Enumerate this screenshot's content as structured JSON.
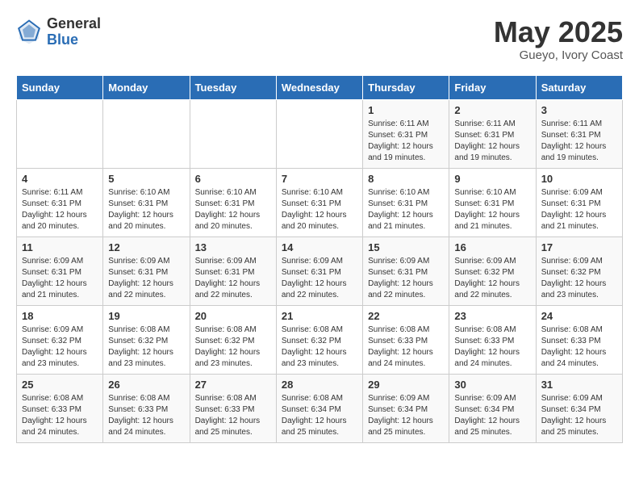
{
  "logo": {
    "text_general": "General",
    "text_blue": "Blue"
  },
  "title": "May 2025",
  "subtitle": "Gueyo, Ivory Coast",
  "days_of_week": [
    "Sunday",
    "Monday",
    "Tuesday",
    "Wednesday",
    "Thursday",
    "Friday",
    "Saturday"
  ],
  "weeks": [
    [
      {
        "day": "",
        "info": ""
      },
      {
        "day": "",
        "info": ""
      },
      {
        "day": "",
        "info": ""
      },
      {
        "day": "",
        "info": ""
      },
      {
        "day": "1",
        "info": "Sunrise: 6:11 AM\nSunset: 6:31 PM\nDaylight: 12 hours\nand 19 minutes."
      },
      {
        "day": "2",
        "info": "Sunrise: 6:11 AM\nSunset: 6:31 PM\nDaylight: 12 hours\nand 19 minutes."
      },
      {
        "day": "3",
        "info": "Sunrise: 6:11 AM\nSunset: 6:31 PM\nDaylight: 12 hours\nand 19 minutes."
      }
    ],
    [
      {
        "day": "4",
        "info": "Sunrise: 6:11 AM\nSunset: 6:31 PM\nDaylight: 12 hours\nand 20 minutes."
      },
      {
        "day": "5",
        "info": "Sunrise: 6:10 AM\nSunset: 6:31 PM\nDaylight: 12 hours\nand 20 minutes."
      },
      {
        "day": "6",
        "info": "Sunrise: 6:10 AM\nSunset: 6:31 PM\nDaylight: 12 hours\nand 20 minutes."
      },
      {
        "day": "7",
        "info": "Sunrise: 6:10 AM\nSunset: 6:31 PM\nDaylight: 12 hours\nand 20 minutes."
      },
      {
        "day": "8",
        "info": "Sunrise: 6:10 AM\nSunset: 6:31 PM\nDaylight: 12 hours\nand 21 minutes."
      },
      {
        "day": "9",
        "info": "Sunrise: 6:10 AM\nSunset: 6:31 PM\nDaylight: 12 hours\nand 21 minutes."
      },
      {
        "day": "10",
        "info": "Sunrise: 6:09 AM\nSunset: 6:31 PM\nDaylight: 12 hours\nand 21 minutes."
      }
    ],
    [
      {
        "day": "11",
        "info": "Sunrise: 6:09 AM\nSunset: 6:31 PM\nDaylight: 12 hours\nand 21 minutes."
      },
      {
        "day": "12",
        "info": "Sunrise: 6:09 AM\nSunset: 6:31 PM\nDaylight: 12 hours\nand 22 minutes."
      },
      {
        "day": "13",
        "info": "Sunrise: 6:09 AM\nSunset: 6:31 PM\nDaylight: 12 hours\nand 22 minutes."
      },
      {
        "day": "14",
        "info": "Sunrise: 6:09 AM\nSunset: 6:31 PM\nDaylight: 12 hours\nand 22 minutes."
      },
      {
        "day": "15",
        "info": "Sunrise: 6:09 AM\nSunset: 6:31 PM\nDaylight: 12 hours\nand 22 minutes."
      },
      {
        "day": "16",
        "info": "Sunrise: 6:09 AM\nSunset: 6:32 PM\nDaylight: 12 hours\nand 22 minutes."
      },
      {
        "day": "17",
        "info": "Sunrise: 6:09 AM\nSunset: 6:32 PM\nDaylight: 12 hours\nand 23 minutes."
      }
    ],
    [
      {
        "day": "18",
        "info": "Sunrise: 6:09 AM\nSunset: 6:32 PM\nDaylight: 12 hours\nand 23 minutes."
      },
      {
        "day": "19",
        "info": "Sunrise: 6:08 AM\nSunset: 6:32 PM\nDaylight: 12 hours\nand 23 minutes."
      },
      {
        "day": "20",
        "info": "Sunrise: 6:08 AM\nSunset: 6:32 PM\nDaylight: 12 hours\nand 23 minutes."
      },
      {
        "day": "21",
        "info": "Sunrise: 6:08 AM\nSunset: 6:32 PM\nDaylight: 12 hours\nand 23 minutes."
      },
      {
        "day": "22",
        "info": "Sunrise: 6:08 AM\nSunset: 6:33 PM\nDaylight: 12 hours\nand 24 minutes."
      },
      {
        "day": "23",
        "info": "Sunrise: 6:08 AM\nSunset: 6:33 PM\nDaylight: 12 hours\nand 24 minutes."
      },
      {
        "day": "24",
        "info": "Sunrise: 6:08 AM\nSunset: 6:33 PM\nDaylight: 12 hours\nand 24 minutes."
      }
    ],
    [
      {
        "day": "25",
        "info": "Sunrise: 6:08 AM\nSunset: 6:33 PM\nDaylight: 12 hours\nand 24 minutes."
      },
      {
        "day": "26",
        "info": "Sunrise: 6:08 AM\nSunset: 6:33 PM\nDaylight: 12 hours\nand 24 minutes."
      },
      {
        "day": "27",
        "info": "Sunrise: 6:08 AM\nSunset: 6:33 PM\nDaylight: 12 hours\nand 25 minutes."
      },
      {
        "day": "28",
        "info": "Sunrise: 6:08 AM\nSunset: 6:34 PM\nDaylight: 12 hours\nand 25 minutes."
      },
      {
        "day": "29",
        "info": "Sunrise: 6:09 AM\nSunset: 6:34 PM\nDaylight: 12 hours\nand 25 minutes."
      },
      {
        "day": "30",
        "info": "Sunrise: 6:09 AM\nSunset: 6:34 PM\nDaylight: 12 hours\nand 25 minutes."
      },
      {
        "day": "31",
        "info": "Sunrise: 6:09 AM\nSunset: 6:34 PM\nDaylight: 12 hours\nand 25 minutes."
      }
    ]
  ]
}
